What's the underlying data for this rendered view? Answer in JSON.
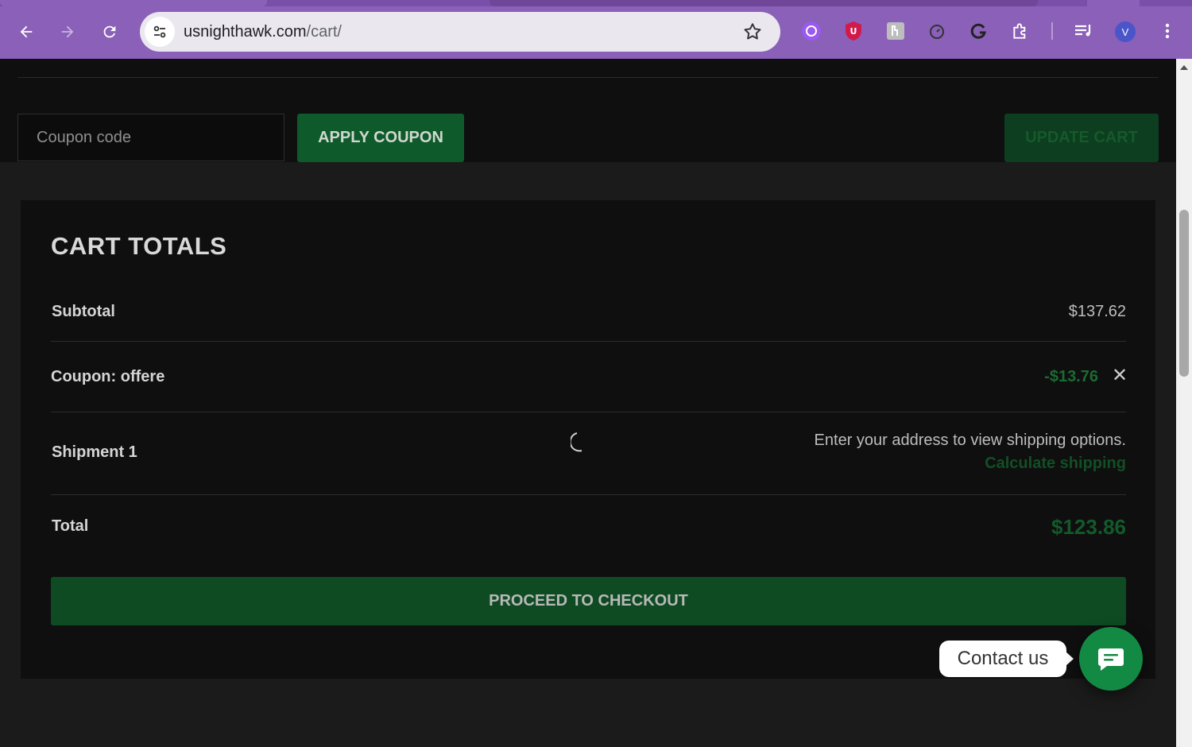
{
  "browser": {
    "url_host": "usnighthawk.com",
    "url_path": "/cart/",
    "profile_initial": "V"
  },
  "cart_actions": {
    "coupon_placeholder": "Coupon code",
    "apply_coupon_label": "APPLY COUPON",
    "update_cart_label": "UPDATE CART"
  },
  "cart_totals": {
    "title": "CART TOTALS",
    "subtotal_label": "Subtotal",
    "subtotal_value": "$137.62",
    "coupon_label": "Coupon: offere",
    "coupon_value": "-$13.76",
    "shipment_label": "Shipment 1",
    "shipping_message": "Enter your address to view shipping options.",
    "calculate_shipping_label": "Calculate shipping",
    "total_label": "Total",
    "total_value": "$123.86",
    "checkout_label": "PROCEED TO CHECKOUT"
  },
  "chat": {
    "contact_label": "Contact us"
  },
  "colors": {
    "brand_green": "#0f5a2a",
    "chrome_purple": "#8a60b8",
    "page_background": "#1b1b1b"
  }
}
